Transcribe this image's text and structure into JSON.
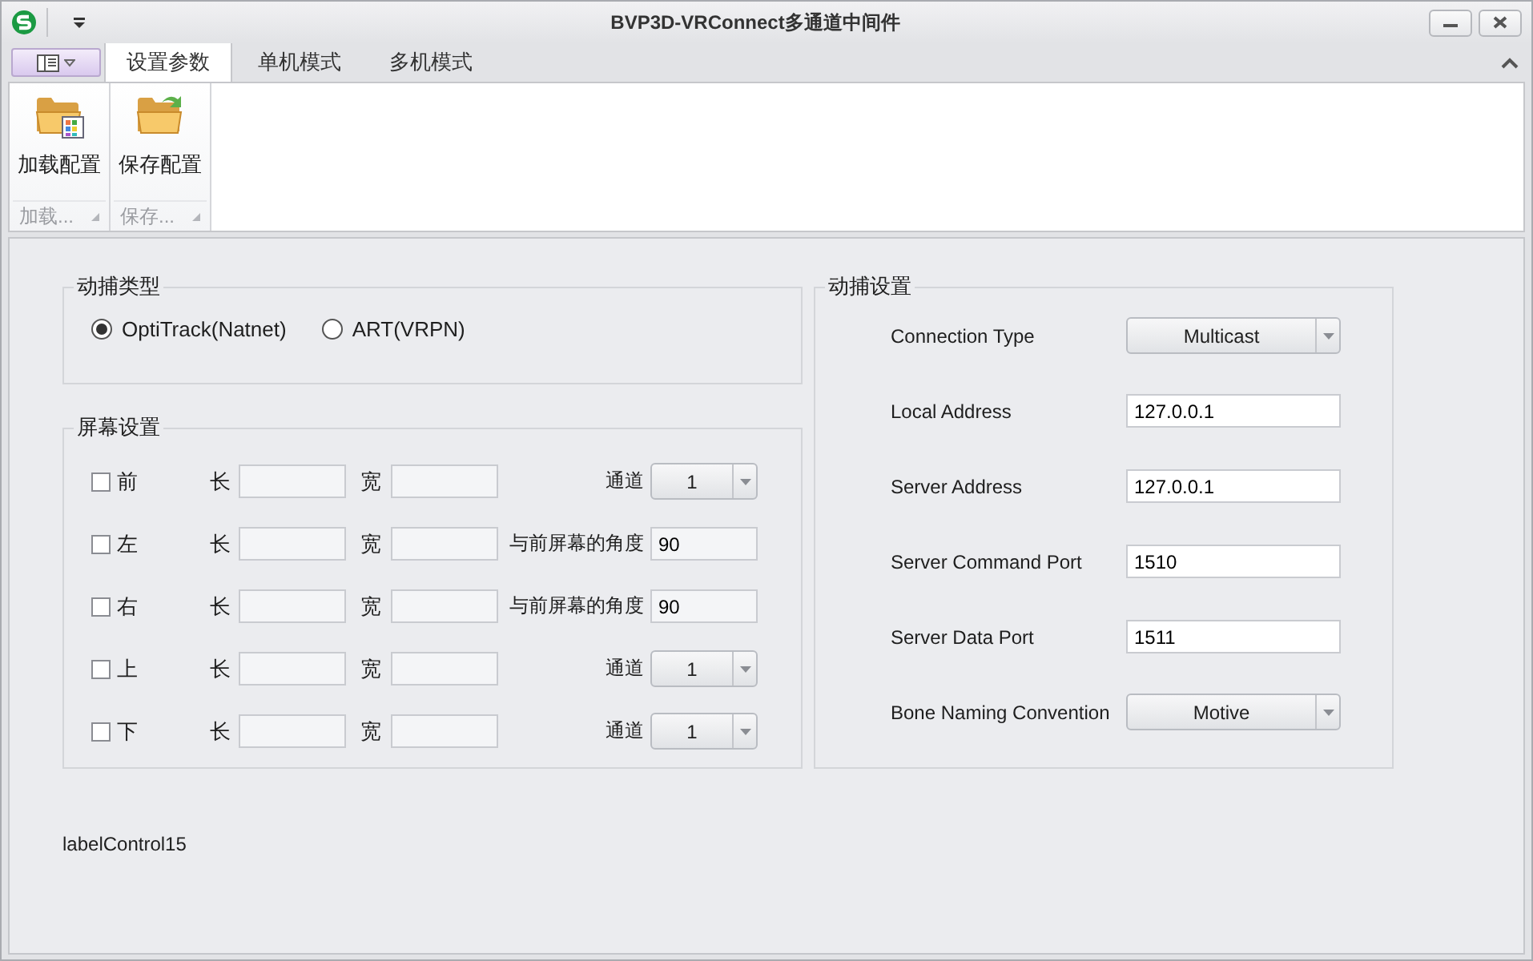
{
  "window": {
    "title": "BVP3D-VRConnect多通道中间件"
  },
  "tabs": [
    {
      "label": "设置参数",
      "selected": true
    },
    {
      "label": "单机模式",
      "selected": false
    },
    {
      "label": "多机模式",
      "selected": false
    }
  ],
  "ribbon_groups": [
    {
      "button": "加载配置",
      "caption": "加载...",
      "kind": "load"
    },
    {
      "button": "保存配置",
      "caption": "保存...",
      "kind": "save"
    }
  ],
  "mocap_type": {
    "title": "动捕类型",
    "options": [
      {
        "label": "OptiTrack(Natnet)",
        "selected": true
      },
      {
        "label": "ART(VRPN)",
        "selected": false
      }
    ]
  },
  "screen_settings": {
    "title": "屏幕设置",
    "rows": [
      {
        "name": "前",
        "checked": false,
        "length_label": "长",
        "width_label": "宽",
        "kind": "channel",
        "extra_label": "通道",
        "extra_value": "1"
      },
      {
        "name": "左",
        "checked": false,
        "length_label": "长",
        "width_label": "宽",
        "kind": "angle",
        "extra_label": "与前屏幕的角度",
        "extra_value": "90"
      },
      {
        "name": "右",
        "checked": false,
        "length_label": "长",
        "width_label": "宽",
        "kind": "angle",
        "extra_label": "与前屏幕的角度",
        "extra_value": "90"
      },
      {
        "name": "上",
        "checked": false,
        "length_label": "长",
        "width_label": "宽",
        "kind": "channel",
        "extra_label": "通道",
        "extra_value": "1"
      },
      {
        "name": "下",
        "checked": false,
        "length_label": "长",
        "width_label": "宽",
        "kind": "channel",
        "extra_label": "通道",
        "extra_value": "1"
      }
    ]
  },
  "mocap_settings": {
    "title": "动捕设置",
    "fields": [
      {
        "label": "Connection Type",
        "kind": "dropdown",
        "value": "Multicast"
      },
      {
        "label": "Local Address",
        "kind": "text",
        "value": "127.0.0.1"
      },
      {
        "label": "Server Address",
        "kind": "text",
        "value": "127.0.0.1"
      },
      {
        "label": "Server Command Port",
        "kind": "text",
        "value": "1510"
      },
      {
        "label": "Server Data Port",
        "kind": "text",
        "value": "1511"
      },
      {
        "label": "Bone Naming Convention",
        "kind": "dropdown",
        "value": "Motive"
      }
    ]
  },
  "status_label": "labelControl15"
}
